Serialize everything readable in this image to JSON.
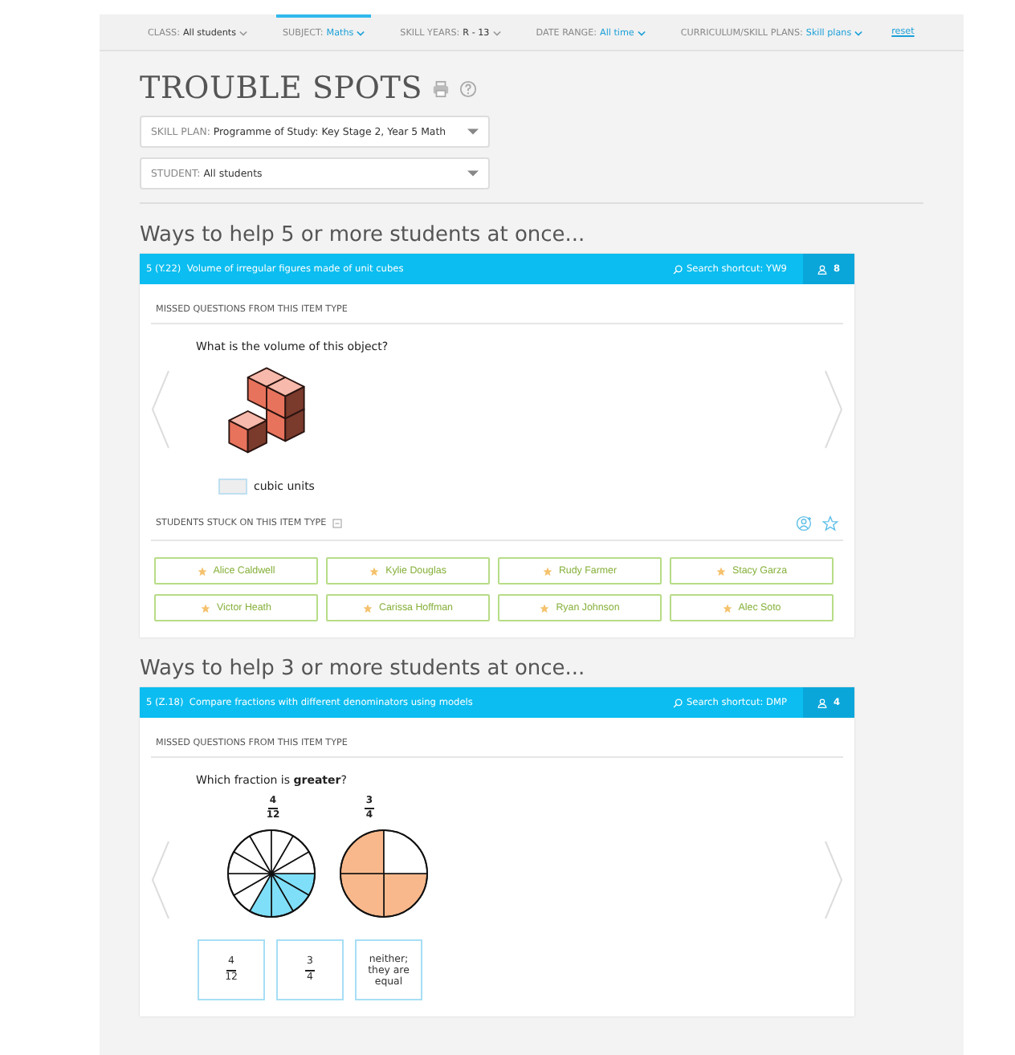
{
  "filters": [
    {
      "label": "CLASS:",
      "value": "All students",
      "selected": false,
      "highlighted": false
    },
    {
      "label": "SUBJECT:",
      "value": "Maths",
      "selected": true,
      "highlighted": true
    },
    {
      "label": "SKILL YEARS:",
      "value": "R - 13",
      "selected": false,
      "highlighted": false
    },
    {
      "label": "DATE RANGE:",
      "value": "All time",
      "selected": false,
      "highlighted": true
    },
    {
      "label": "CURRICULUM/SKILL PLANS:",
      "value": "Skill plans",
      "selected": false,
      "highlighted": true
    }
  ],
  "reset_link": "reset",
  "title": "TROUBLE SPOTS",
  "selects": [
    {
      "label": "SKILL PLAN:",
      "value": "Programme of Study: Key Stage 2, Year 5 Math"
    },
    {
      "label": "STUDENT:",
      "value": "All students"
    }
  ],
  "sections": [
    {
      "heading": "Ways to help 5 or more students at once...",
      "skill": "5 (Y.22)  Volume of irregular figures made of unit cubes",
      "shortcut": "Search shortcut: YW9",
      "count": "8",
      "missed_label": "MISSED QUESTIONS FROM THIS ITEM TYPE",
      "question": {
        "kind": "volume",
        "prompt": "What is the volume of this object?",
        "unit": "cubic units"
      },
      "stuck_label": "STUDENTS STUCK ON THIS ITEM TYPE",
      "students": [
        "Alice Caldwell",
        "Kylie Douglas",
        "Rudy Farmer",
        "Stacy Garza",
        "Victor Heath",
        "Carissa Hoffman",
        "Ryan Johnson",
        "Alec Soto"
      ]
    },
    {
      "heading": "Ways to help 3 or more students at once...",
      "skill": "5 (Z.18)  Compare fractions with different denominators using models",
      "shortcut": "Search shortcut: DMP",
      "count": "4",
      "missed_label": "MISSED QUESTIONS FROM THIS ITEM TYPE",
      "question": {
        "kind": "fractions",
        "prompt": "Which fraction is **greater**?",
        "models": [
          {
            "numerator": "4",
            "denominator": "12",
            "color": "#7fdff8"
          },
          {
            "numerator": "3",
            "denominator": "4",
            "color": "#f9b88b"
          }
        ],
        "choices": [
          {
            "kind": "fraction",
            "numerator": "4",
            "denominator": "12"
          },
          {
            "kind": "fraction",
            "numerator": "3",
            "denominator": "4"
          },
          {
            "kind": "text",
            "text": "neither; they are equal"
          }
        ]
      }
    }
  ]
}
